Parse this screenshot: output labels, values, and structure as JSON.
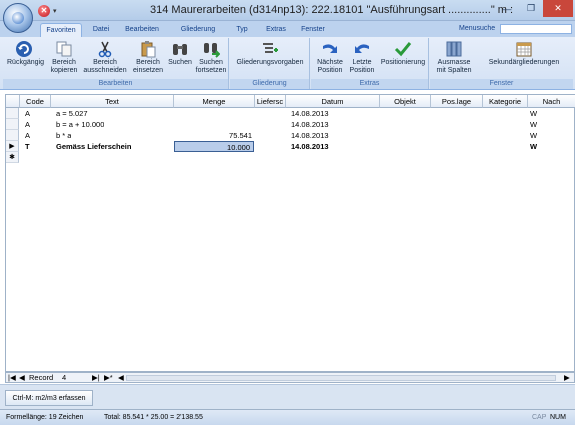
{
  "window": {
    "title": "314 Maurerarbeiten (d314np13): 222.18101  \"Ausführungsart ..............\" m  :",
    "controls": [
      "—",
      "❐",
      "✕"
    ]
  },
  "tabs": [
    "Favoriten",
    "Datei",
    "Bearbeiten",
    "Gliederung",
    "Typ",
    "Extras",
    "Fenster"
  ],
  "menusuche": {
    "label": "Menusuche",
    "value": ""
  },
  "ribbon": {
    "groups": [
      {
        "label": "Bearbeiten",
        "buttons": [
          {
            "label": "Rückgängig",
            "icon": "undo-icon"
          },
          {
            "label": "Bereich kopieren",
            "icon": "copy-icon"
          },
          {
            "label": "Bereich ausschneiden",
            "icon": "scissors-icon"
          },
          {
            "label": "Bereich einsetzen",
            "icon": "paste-icon"
          },
          {
            "label": "Suchen",
            "icon": "binoculars-icon"
          },
          {
            "label": "Suchen fortsetzen",
            "icon": "binoculars-next-icon"
          }
        ]
      },
      {
        "label": "Gliederung",
        "buttons": [
          {
            "label": "Gliederungsvorgaben",
            "icon": "outline-icon"
          }
        ]
      },
      {
        "label": "Extras",
        "buttons": [
          {
            "label": "Nächste Position",
            "icon": "next-arrow-icon"
          },
          {
            "label": "Letzte Position",
            "icon": "prev-arrow-icon"
          },
          {
            "label": "Positionierung",
            "icon": "checkmark-icon"
          }
        ]
      },
      {
        "label": "Fenster",
        "buttons": [
          {
            "label": "Ausmasse mit Spalten",
            "icon": "columns-icon"
          },
          {
            "label": "Sekundärgliederungen",
            "icon": "calendar-grid-icon"
          }
        ]
      }
    ]
  },
  "grid": {
    "columns": [
      "Code",
      "Text",
      "Menge",
      "Liefersc",
      "Datum",
      "Objekt",
      "Pos.lage",
      "Kategorie",
      "Nach"
    ],
    "rows": [
      {
        "marker": "",
        "code": "A",
        "text": "a =    5.027",
        "menge": "",
        "datum": "14.08.2013",
        "kategorie": "W",
        "bold": false
      },
      {
        "marker": "",
        "code": "A",
        "text": "b = a +   10.000",
        "menge": "",
        "datum": "14.08.2013",
        "kategorie": "W",
        "bold": false
      },
      {
        "marker": "",
        "code": "A",
        "text": "b * a",
        "menge": "75.541",
        "datum": "14.08.2013",
        "kategorie": "W",
        "bold": false
      },
      {
        "marker": "▶",
        "code": "T",
        "text": "Gemäss Lieferschein",
        "menge": "10.000",
        "datum": "14.08.2013",
        "kategorie": "W",
        "bold": true
      },
      {
        "marker": "✱",
        "code": "",
        "text": "",
        "menge": "",
        "datum": "",
        "kategorie": "",
        "bold": false
      }
    ]
  },
  "navigator": {
    "record_label": "Record",
    "record_value": "4"
  },
  "shortcut": {
    "label": "Ctrl-M: m2/m3 erfassen"
  },
  "status": {
    "left": "Formellänge: 19 Zeichen",
    "middle": "Total: 85.541 * 25.00 = 2'138.55",
    "cap": "CAP",
    "num": "NUM"
  }
}
